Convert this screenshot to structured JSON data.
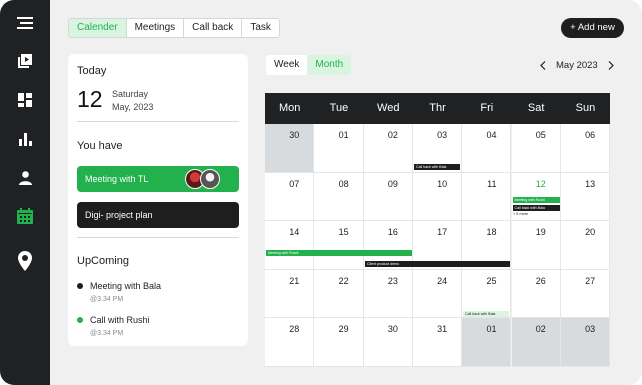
{
  "view_tabs": [
    "Calender",
    "Meetings",
    "Call back",
    "Task"
  ],
  "add_button": "+ Add new",
  "today": {
    "heading": "Today",
    "day_number": "12",
    "weekday": "Saturday",
    "month_year": "May, 2023"
  },
  "you_have": {
    "heading": "You have",
    "items": [
      "Meeting with TL",
      "Digi- project plan"
    ]
  },
  "upcoming": {
    "heading": "UpComing",
    "items": [
      {
        "title": "Meeting with Bala",
        "time": "@3.34 PM"
      },
      {
        "title": "Call with Rushi",
        "time": "@3.34 PM"
      }
    ]
  },
  "calendar": {
    "view_options": [
      "Week",
      "Month"
    ],
    "active_view": "Month",
    "month_label": "May 2023",
    "weekdays": [
      "Mon",
      "Tue",
      "Wed",
      "Thr",
      "Fri",
      "Sat",
      "Sun"
    ],
    "weeks": [
      [
        "30",
        "01",
        "02",
        "03",
        "04",
        "05",
        "06"
      ],
      [
        "07",
        "08",
        "09",
        "10",
        "11",
        "12",
        "13"
      ],
      [
        "14",
        "15",
        "16",
        "17",
        "18",
        "19",
        "20"
      ],
      [
        "21",
        "22",
        "23",
        "24",
        "25",
        "26",
        "27"
      ],
      [
        "28",
        "29",
        "30",
        "31",
        "01",
        "02",
        "03"
      ]
    ],
    "events": {
      "call_back_bala_1": "Call back with Bala",
      "meeting_rushi_sat": "Meeting with Rushi",
      "call_back_bala_2": "Call back with Bala",
      "more": "+ 5 more",
      "meeting_rushi_week": "Meeting with Rushi",
      "client_demo": "Client product demo",
      "call_back_bala_3": "Call back with Bala"
    }
  },
  "colors": {
    "sidebar": "#1f2123",
    "accent_green": "#22b14c",
    "dark": "#1e1e1e",
    "light_green": "#d9f5df"
  },
  "sidebar_icons": [
    "menu-icon",
    "media-icon",
    "dashboard-icon",
    "chart-icon",
    "user-icon",
    "calendar-icon",
    "location-icon"
  ]
}
